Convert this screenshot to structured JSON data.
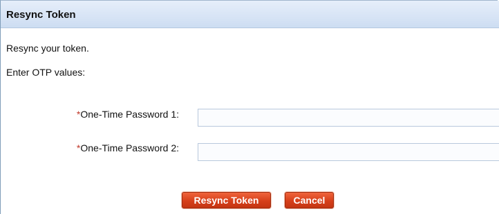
{
  "dialog": {
    "title": "Resync Token",
    "intro_text": "Resync your token.",
    "instruction_text": "Enter OTP values:"
  },
  "form": {
    "required_marker": "*",
    "fields": [
      {
        "label": "One-Time Password 1:",
        "value": "",
        "placeholder": ""
      },
      {
        "label": "One-Time Password 2:",
        "value": "",
        "placeholder": ""
      }
    ]
  },
  "buttons": {
    "resync_label": "Resync Token",
    "cancel_label": "Cancel"
  },
  "colors": {
    "title_bar": "#cdddf2",
    "required_marker": "#c0392b",
    "button": "#d6401a"
  }
}
